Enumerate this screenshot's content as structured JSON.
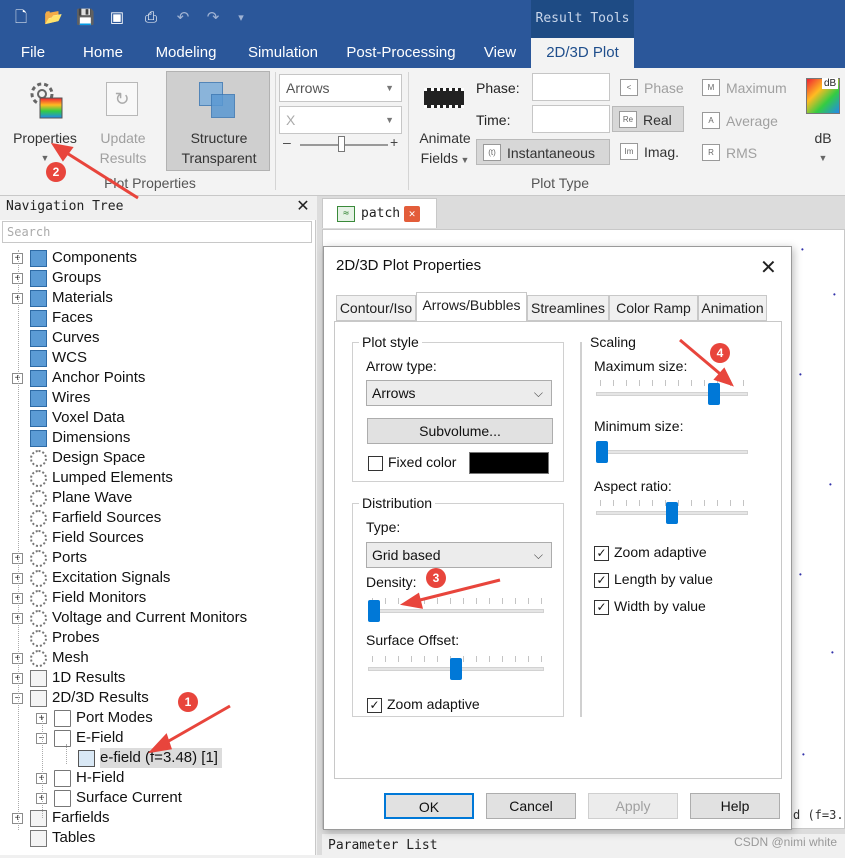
{
  "ribbon_tabs": {
    "context_label": "Result Tools",
    "items": [
      "File",
      "Home",
      "Modeling",
      "Simulation",
      "Post-Processing",
      "View",
      "2D/3D Plot"
    ],
    "active": "2D/3D Plot"
  },
  "ribbon": {
    "properties_label": "Properties",
    "update_results_line1": "Update",
    "update_results_line2": "Results",
    "structure_transparent_line1": "Structure",
    "structure_transparent_line2": "Transparent",
    "plot_properties_group": "Plot Properties",
    "arrows_combo": "Arrows",
    "axis_combo": "X",
    "slider_minus": "–",
    "slider_plus": "+",
    "animate_fields_line1": "Animate",
    "animate_fields_line2": "Fields",
    "phase_label": "Phase:",
    "time_label": "Time:",
    "instantaneous_label": "Instantaneous",
    "phase_option": "Phase",
    "real_option": "Real",
    "imag_option": "Imag.",
    "maximum_option": "Maximum",
    "average_option": "Average",
    "rms_option": "RMS",
    "db_label": "dB",
    "plot_type_group": "Plot Type"
  },
  "navigation_tree": {
    "title": "Navigation Tree",
    "search_placeholder": "Search",
    "items": [
      {
        "label": "Components"
      },
      {
        "label": "Groups"
      },
      {
        "label": "Materials"
      },
      {
        "label": "Faces"
      },
      {
        "label": "Curves"
      },
      {
        "label": "WCS"
      },
      {
        "label": "Anchor Points"
      },
      {
        "label": "Wires"
      },
      {
        "label": "Voxel Data"
      },
      {
        "label": "Dimensions"
      },
      {
        "label": "Design Space"
      },
      {
        "label": "Lumped Elements"
      },
      {
        "label": "Plane Wave"
      },
      {
        "label": "Farfield Sources"
      },
      {
        "label": "Field Sources"
      },
      {
        "label": "Ports"
      },
      {
        "label": "Excitation Signals"
      },
      {
        "label": "Field Monitors"
      },
      {
        "label": "Voltage and Current Monitors"
      },
      {
        "label": "Probes"
      },
      {
        "label": "Mesh"
      },
      {
        "label": "1D Results"
      },
      {
        "label": "2D/3D Results"
      },
      {
        "label": "Port Modes"
      },
      {
        "label": "E-Field"
      },
      {
        "label": "e-field (f=3.48) [1]"
      },
      {
        "label": "H-Field"
      },
      {
        "label": "Surface Current"
      },
      {
        "label": "Farfields"
      },
      {
        "label": "Tables"
      }
    ]
  },
  "document": {
    "tab_label": "patch",
    "status_text": "d (f=3.",
    "parameter_list": "Parameter List"
  },
  "dialog": {
    "title": "2D/3D Plot Properties",
    "tabs": [
      "Contour/Iso",
      "Arrows/Bubbles",
      "Streamlines",
      "Color Ramp",
      "Animation"
    ],
    "active_tab": "Arrows/Bubbles",
    "plot_style_group": "Plot style",
    "arrow_type_label": "Arrow type:",
    "arrow_type_value": "Arrows",
    "subvolume_button": "Subvolume...",
    "fixed_color_label": "Fixed color",
    "fixed_color_checked": false,
    "fixed_color_value": "#000000",
    "distribution_group": "Distribution",
    "type_label": "Type:",
    "type_value": "Grid based",
    "density_label": "Density:",
    "density_level": 0.0,
    "surface_offset_label": "Surface Offset:",
    "surface_offset_level": 0.5,
    "zoom_adaptive_dist_label": "Zoom adaptive",
    "zoom_adaptive_dist_checked": true,
    "scaling_group": "Scaling",
    "max_size_label": "Maximum size:",
    "max_size_level": 0.8,
    "min_size_label": "Minimum size:",
    "min_size_level": 0.0,
    "aspect_ratio_label": "Aspect ratio:",
    "aspect_ratio_level": 0.5,
    "zoom_adaptive_scale_label": "Zoom adaptive",
    "zoom_adaptive_scale_checked": true,
    "length_by_value_label": "Length by value",
    "length_by_value_checked": true,
    "width_by_value_label": "Width by value",
    "width_by_value_checked": true,
    "ok_button": "OK",
    "cancel_button": "Cancel",
    "apply_button": "Apply",
    "help_button": "Help"
  },
  "annotations": [
    "1",
    "2",
    "3",
    "4"
  ],
  "colors": {
    "ribbon_blue": "#2b579a",
    "slider_thumb": "#0078d7",
    "annotation_red": "#e8453c"
  },
  "watermark": "CSDN @nimi white"
}
